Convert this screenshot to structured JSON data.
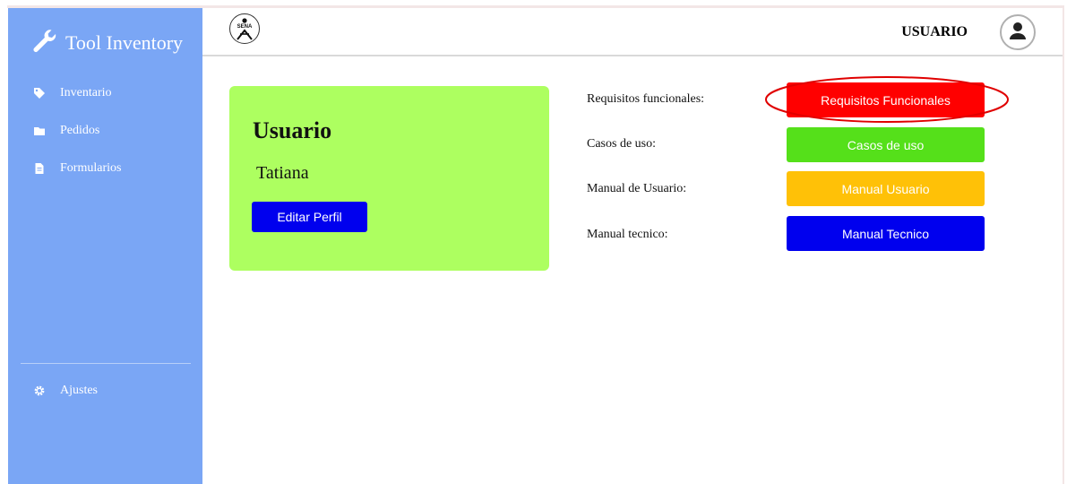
{
  "sidebar": {
    "brand": {
      "title": "Tool Inventory",
      "icon": "wrench-icon"
    },
    "items": [
      {
        "label": "Inventario",
        "icon": "tag-icon"
      },
      {
        "label": "Pedidos",
        "icon": "folder-icon"
      },
      {
        "label": "Formularios",
        "icon": "document-icon"
      }
    ],
    "settings": {
      "label": "Ajustes",
      "icon": "gear-icon"
    },
    "background_color": "#7aa6f5"
  },
  "header": {
    "logo": "sena-logo",
    "user_title": "USUARIO",
    "avatar_icon": "user-icon"
  },
  "profile": {
    "heading": "Usuario",
    "name": "Tatiana",
    "edit_button": "Editar Perfil",
    "card_color": "#adff60",
    "button_color": "#0000ee"
  },
  "documents": [
    {
      "label": "Requisitos funcionales:",
      "button": "Requisitos Funcionales",
      "color": "#ff0000",
      "highlighted": true
    },
    {
      "label": "Casos de uso:",
      "button": "Casos de uso",
      "color": "#55e01a",
      "highlighted": false
    },
    {
      "label": "Manual de Usuario:",
      "button": "Manual Usuario",
      "color": "#ffc107",
      "highlighted": false
    },
    {
      "label": "Manual tecnico:",
      "button": "Manual Tecnico",
      "color": "#0000ee",
      "highlighted": false
    }
  ]
}
